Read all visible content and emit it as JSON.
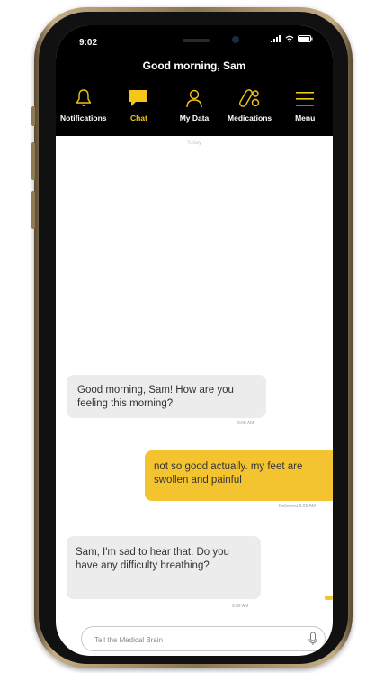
{
  "status_bar": {
    "time": "9:02"
  },
  "header": {
    "greeting": "Good morning, Sam"
  },
  "nav": {
    "notifications": "Notifications",
    "chat": "Chat",
    "my_data": "My Data",
    "medications": "Medications",
    "menu": "Menu",
    "active": "chat"
  },
  "chat": {
    "date_divider": "Today",
    "messages": [
      {
        "sender": "bot",
        "text": "Good morning, Sam! How are you feeling this morning?",
        "time": "9:00 AM"
      },
      {
        "sender": "user",
        "text": "not so good actually. my feet are swollen and painful",
        "time": "Delivered 9:02 AM"
      },
      {
        "sender": "bot",
        "text": "Sam, I'm sad to hear that. Do you have any difficulty breathing?",
        "time": "9:02 AM"
      }
    ]
  },
  "input": {
    "placeholder": "Tell the Medical Brain"
  },
  "colors": {
    "accent": "#f5c518",
    "header_bg": "#000000",
    "bot_bubble": "#ececec",
    "user_bubble": "#f4c430",
    "frame": "#c4ad86"
  },
  "icons": [
    "bell-icon",
    "chat-bubble-icon",
    "person-icon",
    "pills-icon",
    "hamburger-menu-icon",
    "microphone-icon",
    "signal-icon",
    "wifi-icon",
    "battery-icon"
  ]
}
